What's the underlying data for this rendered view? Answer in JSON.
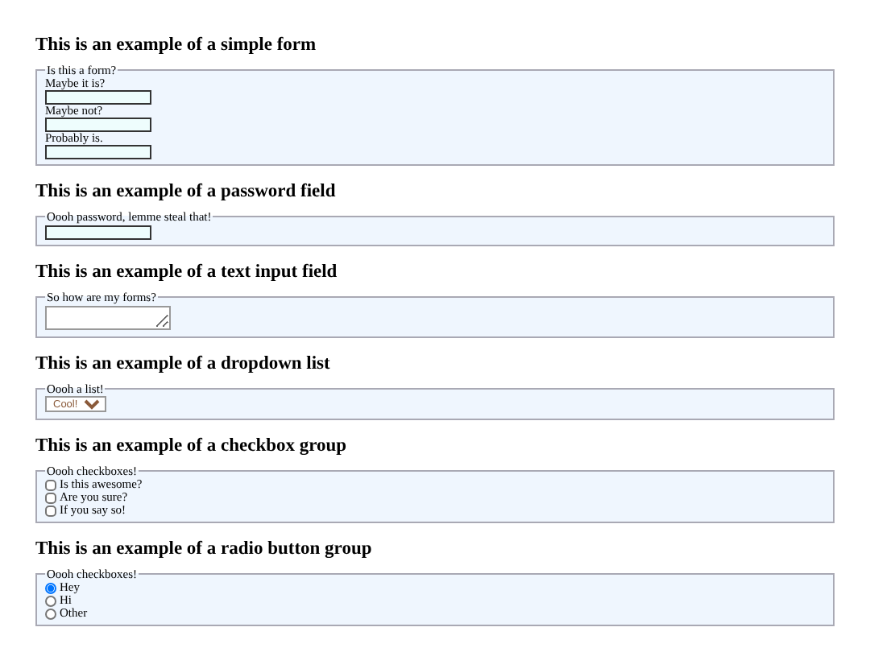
{
  "sections": [
    {
      "kind": "fields",
      "heading": "This is an example of a simple form",
      "legend": "Is this a form?",
      "fields": [
        {
          "label": "Maybe it is?"
        },
        {
          "label": "Maybe not?"
        },
        {
          "label": "Probably is."
        }
      ]
    },
    {
      "kind": "password",
      "heading": "This is an example of a password field",
      "legend": "Oooh password, lemme steal that!"
    },
    {
      "kind": "textarea",
      "heading": "This is an example of a text input field",
      "legend": "So how are my forms?"
    },
    {
      "kind": "dropdown",
      "heading": "This is an example of a dropdown list",
      "legend": "Oooh a list!",
      "value": "Cool!"
    },
    {
      "kind": "checkboxes",
      "heading": "This is an example of a checkbox group",
      "legend": "Oooh checkboxes!",
      "options": [
        {
          "label": "Is this awesome?",
          "checked": false
        },
        {
          "label": "Are you sure?",
          "checked": false
        },
        {
          "label": "If you say so!",
          "checked": false
        }
      ]
    },
    {
      "kind": "radios",
      "heading": "This is an example of a radio button group",
      "legend": "Oooh checkboxes!",
      "options": [
        {
          "label": "Hey",
          "selected": true
        },
        {
          "label": "Hi",
          "selected": false
        },
        {
          "label": "Other",
          "selected": false
        }
      ]
    }
  ]
}
